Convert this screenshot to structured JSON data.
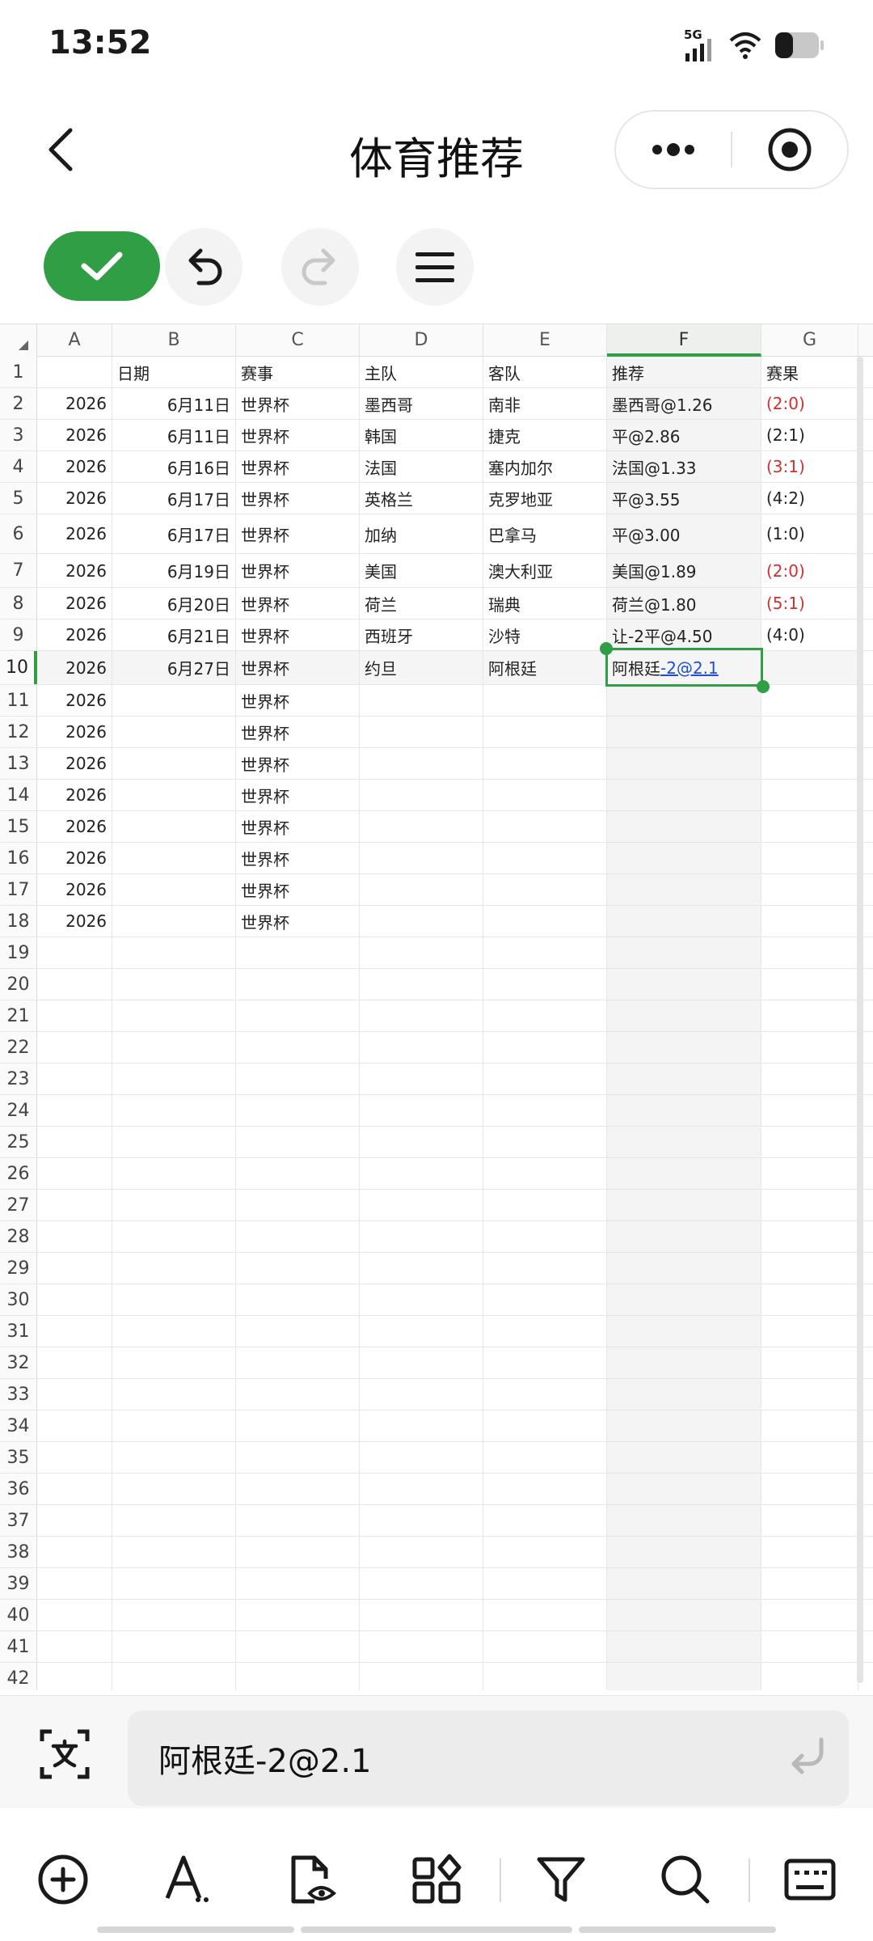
{
  "status_bar": {
    "time": "13:52",
    "network": "5G"
  },
  "header": {
    "title": "体育推荐"
  },
  "formula_bar": {
    "value": "阿根廷-2@2.1"
  },
  "sheet": {
    "columns": [
      "A",
      "B",
      "C",
      "D",
      "E",
      "F",
      "G"
    ],
    "active_column": "F",
    "active_row": "10",
    "rows": [
      {
        "n": "1",
        "a": "",
        "b": "日期",
        "c": "赛事",
        "d": "主队",
        "e": "客队",
        "f": "推荐",
        "g": "赛果",
        "g_red": false
      },
      {
        "n": "2",
        "a": "2026",
        "b": "6月11日",
        "c": "世界杯",
        "d": "墨西哥",
        "e": "南非",
        "f": "墨西哥@1.26",
        "g": "(2:0)",
        "g_red": true
      },
      {
        "n": "3",
        "a": "2026",
        "b": "6月11日",
        "c": "世界杯",
        "d": "韩国",
        "e": "捷克",
        "f": "平@2.86",
        "g": "(2:1)",
        "g_red": false
      },
      {
        "n": "4",
        "a": "2026",
        "b": "6月16日",
        "c": "世界杯",
        "d": "法国",
        "e": "塞内加尔",
        "f": "法国@1.33",
        "g": "(3:1)",
        "g_red": true
      },
      {
        "n": "5",
        "a": "2026",
        "b": "6月17日",
        "c": "世界杯",
        "d": "英格兰",
        "e": "克罗地亚",
        "f": "平@3.55",
        "g": "(4:2)",
        "g_red": false
      },
      {
        "n": "6",
        "a": "2026",
        "b": "6月17日",
        "c": "世界杯",
        "d": "加纳",
        "e": "巴拿马",
        "f": "平@3.00",
        "g": "(1:0)",
        "g_red": false
      },
      {
        "n": "7",
        "a": "2026",
        "b": "6月19日",
        "c": "世界杯",
        "d": "美国",
        "e": "澳大利亚",
        "f": "美国@1.89",
        "g": "(2:0)",
        "g_red": true
      },
      {
        "n": "8",
        "a": "2026",
        "b": "6月20日",
        "c": "世界杯",
        "d": "荷兰",
        "e": "瑞典",
        "f": "荷兰@1.80",
        "g": "(5:1)",
        "g_red": true
      },
      {
        "n": "9",
        "a": "2026",
        "b": "6月21日",
        "c": "世界杯",
        "d": "西班牙",
        "e": "沙特",
        "f": "让-2平@4.50",
        "g": "(4:0)",
        "g_red": false
      },
      {
        "n": "10",
        "a": "2026",
        "b": "6月27日",
        "c": "世界杯",
        "d": "约旦",
        "e": "阿根廷",
        "f": "阿根廷-2@2.1",
        "f_plain": "阿根廷",
        "f_link": "-2@2.1",
        "g": "",
        "g_red": false
      },
      {
        "n": "11",
        "a": "2026",
        "b": "",
        "c": "世界杯",
        "d": "",
        "e": "",
        "f": "",
        "g": "",
        "g_red": false
      },
      {
        "n": "12",
        "a": "2026",
        "b": "",
        "c": "世界杯",
        "d": "",
        "e": "",
        "f": "",
        "g": "",
        "g_red": false
      },
      {
        "n": "13",
        "a": "2026",
        "b": "",
        "c": "世界杯",
        "d": "",
        "e": "",
        "f": "",
        "g": "",
        "g_red": false
      },
      {
        "n": "14",
        "a": "2026",
        "b": "",
        "c": "世界杯",
        "d": "",
        "e": "",
        "f": "",
        "g": "",
        "g_red": false
      },
      {
        "n": "15",
        "a": "2026",
        "b": "",
        "c": "世界杯",
        "d": "",
        "e": "",
        "f": "",
        "g": "",
        "g_red": false
      },
      {
        "n": "16",
        "a": "2026",
        "b": "",
        "c": "世界杯",
        "d": "",
        "e": "",
        "f": "",
        "g": "",
        "g_red": false
      },
      {
        "n": "17",
        "a": "2026",
        "b": "",
        "c": "世界杯",
        "d": "",
        "e": "",
        "f": "",
        "g": "",
        "g_red": false
      },
      {
        "n": "18",
        "a": "2026",
        "b": "",
        "c": "世界杯",
        "d": "",
        "e": "",
        "f": "",
        "g": "",
        "g_red": false
      },
      {
        "n": "19"
      },
      {
        "n": "20"
      },
      {
        "n": "21"
      },
      {
        "n": "22"
      },
      {
        "n": "23"
      },
      {
        "n": "24"
      },
      {
        "n": "25"
      },
      {
        "n": "26"
      },
      {
        "n": "27"
      },
      {
        "n": "28"
      },
      {
        "n": "29"
      },
      {
        "n": "30"
      },
      {
        "n": "31"
      },
      {
        "n": "32"
      },
      {
        "n": "33"
      },
      {
        "n": "34"
      },
      {
        "n": "35"
      },
      {
        "n": "36"
      },
      {
        "n": "37"
      },
      {
        "n": "38"
      },
      {
        "n": "39"
      },
      {
        "n": "40"
      },
      {
        "n": "41"
      },
      {
        "n": "42"
      }
    ]
  },
  "colors": {
    "accent": "#2f9e44",
    "result_red": "#d32f2f",
    "link_blue": "#1a4fd6"
  },
  "icons": {
    "status": [
      "signal-icon",
      "wifi-icon",
      "battery-icon"
    ],
    "header": [
      "back-icon",
      "more-icon",
      "record-icon"
    ],
    "toolbar": [
      "check-icon",
      "undo-icon",
      "redo-icon",
      "menu-icon"
    ],
    "formula": [
      "translate-icon",
      "enter-icon"
    ],
    "bottom": [
      "insert-icon",
      "font-style-icon",
      "view-file-icon",
      "widgets-icon",
      "filter-icon",
      "search-icon",
      "keyboard-icon"
    ]
  }
}
